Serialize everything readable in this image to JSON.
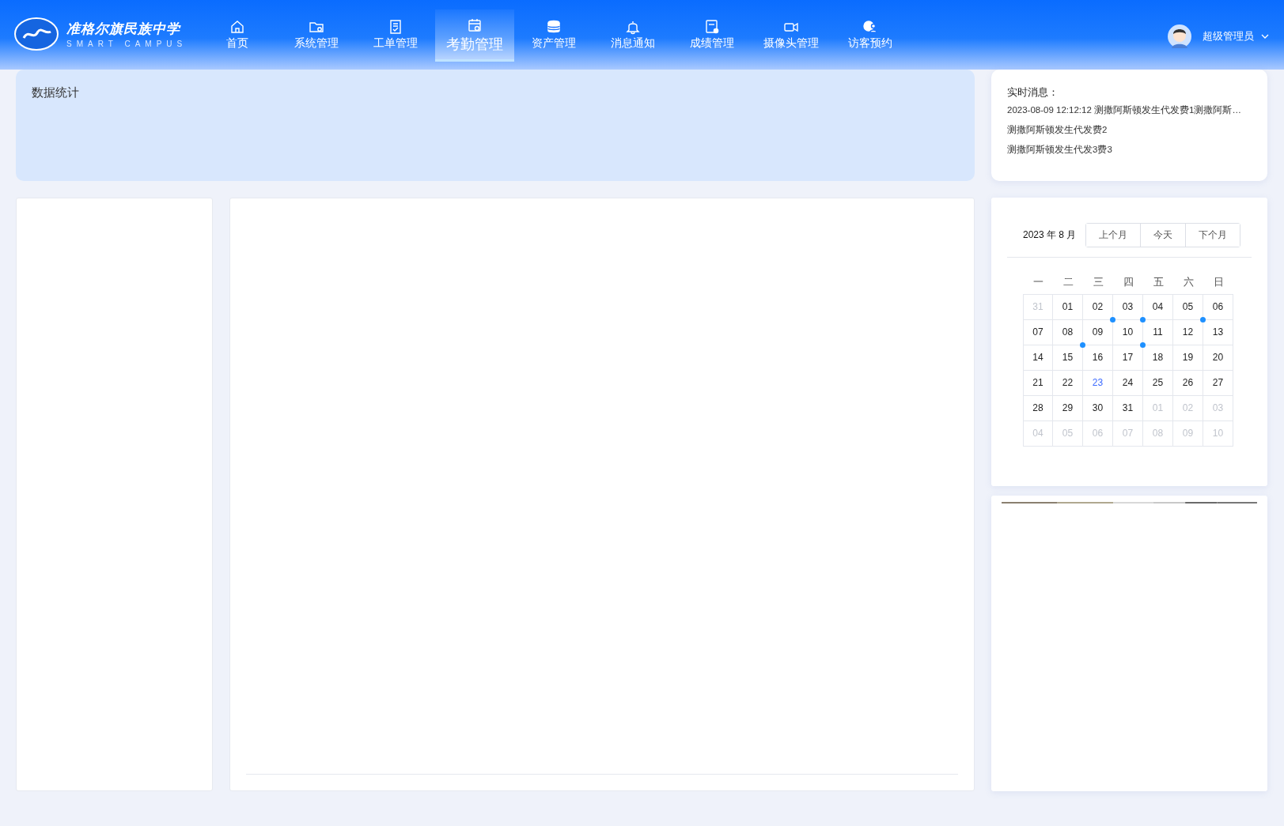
{
  "logo": {
    "title": "准格尔旗民族中学",
    "subtitle": "SMART CAMPUS"
  },
  "nav": [
    {
      "label": "首页",
      "selected": false
    },
    {
      "label": "系统管理",
      "selected": false
    },
    {
      "label": "工单管理",
      "selected": false
    },
    {
      "label": "考勤管理",
      "selected": true
    },
    {
      "label": "资产管理",
      "selected": false
    },
    {
      "label": "消息通知",
      "selected": false
    },
    {
      "label": "成绩管理",
      "selected": false
    },
    {
      "label": "摄像头管理",
      "selected": false
    },
    {
      "label": "访客预约",
      "selected": false
    }
  ],
  "user": {
    "name": "超级管理员"
  },
  "stats": {
    "title": "数据统计"
  },
  "messages": {
    "title": "实时消息：",
    "items": [
      "2023-08-09 12:12:12 测撒阿斯顿发生代发费1测撒阿斯…",
      "测撒阿斯顿发生代发费2",
      "测撒阿斯顿发生代发3费3"
    ]
  },
  "calendar": {
    "month": "2023 年 8 月",
    "buttons": [
      "上个月",
      "今天",
      "下个月"
    ],
    "weekdays": [
      "一",
      "二",
      "三",
      "四",
      "五",
      "六",
      "日"
    ],
    "days": [
      {
        "label": "31",
        "muted": true,
        "selected": false,
        "dot": false
      },
      {
        "label": "01",
        "muted": false,
        "selected": false,
        "dot": false
      },
      {
        "label": "02",
        "muted": false,
        "selected": false,
        "dot": true
      },
      {
        "label": "03",
        "muted": false,
        "selected": false,
        "dot": true
      },
      {
        "label": "04",
        "muted": false,
        "selected": false,
        "dot": false
      },
      {
        "label": "05",
        "muted": false,
        "selected": false,
        "dot": true
      },
      {
        "label": "06",
        "muted": false,
        "selected": false,
        "dot": false
      },
      {
        "label": "07",
        "muted": false,
        "selected": false,
        "dot": false
      },
      {
        "label": "08",
        "muted": false,
        "selected": false,
        "dot": true
      },
      {
        "label": "09",
        "muted": false,
        "selected": false,
        "dot": false
      },
      {
        "label": "10",
        "muted": false,
        "selected": false,
        "dot": true
      },
      {
        "label": "11",
        "muted": false,
        "selected": false,
        "dot": false
      },
      {
        "label": "12",
        "muted": false,
        "selected": false,
        "dot": false
      },
      {
        "label": "13",
        "muted": false,
        "selected": false,
        "dot": false
      },
      {
        "label": "14",
        "muted": false,
        "selected": false,
        "dot": false
      },
      {
        "label": "15",
        "muted": false,
        "selected": false,
        "dot": false
      },
      {
        "label": "16",
        "muted": false,
        "selected": false,
        "dot": false
      },
      {
        "label": "17",
        "muted": false,
        "selected": false,
        "dot": false
      },
      {
        "label": "18",
        "muted": false,
        "selected": false,
        "dot": false
      },
      {
        "label": "19",
        "muted": false,
        "selected": false,
        "dot": false
      },
      {
        "label": "20",
        "muted": false,
        "selected": false,
        "dot": false
      },
      {
        "label": "21",
        "muted": false,
        "selected": false,
        "dot": false
      },
      {
        "label": "22",
        "muted": false,
        "selected": false,
        "dot": false
      },
      {
        "label": "23",
        "muted": false,
        "selected": true,
        "dot": false
      },
      {
        "label": "24",
        "muted": false,
        "selected": false,
        "dot": false
      },
      {
        "label": "25",
        "muted": false,
        "selected": false,
        "dot": false
      },
      {
        "label": "26",
        "muted": false,
        "selected": false,
        "dot": false
      },
      {
        "label": "27",
        "muted": false,
        "selected": false,
        "dot": false
      },
      {
        "label": "28",
        "muted": false,
        "selected": false,
        "dot": false
      },
      {
        "label": "29",
        "muted": false,
        "selected": false,
        "dot": false
      },
      {
        "label": "30",
        "muted": false,
        "selected": false,
        "dot": false
      },
      {
        "label": "31",
        "muted": false,
        "selected": false,
        "dot": false
      },
      {
        "label": "01",
        "muted": true,
        "selected": false,
        "dot": false
      },
      {
        "label": "02",
        "muted": true,
        "selected": false,
        "dot": false
      },
      {
        "label": "03",
        "muted": true,
        "selected": false,
        "dot": false
      },
      {
        "label": "04",
        "muted": true,
        "selected": false,
        "dot": false
      },
      {
        "label": "05",
        "muted": true,
        "selected": false,
        "dot": false
      },
      {
        "label": "06",
        "muted": true,
        "selected": false,
        "dot": false
      },
      {
        "label": "07",
        "muted": true,
        "selected": false,
        "dot": false
      },
      {
        "label": "08",
        "muted": true,
        "selected": false,
        "dot": false
      },
      {
        "label": "09",
        "muted": true,
        "selected": false,
        "dot": false
      },
      {
        "label": "10",
        "muted": true,
        "selected": false,
        "dot": false
      }
    ]
  }
}
